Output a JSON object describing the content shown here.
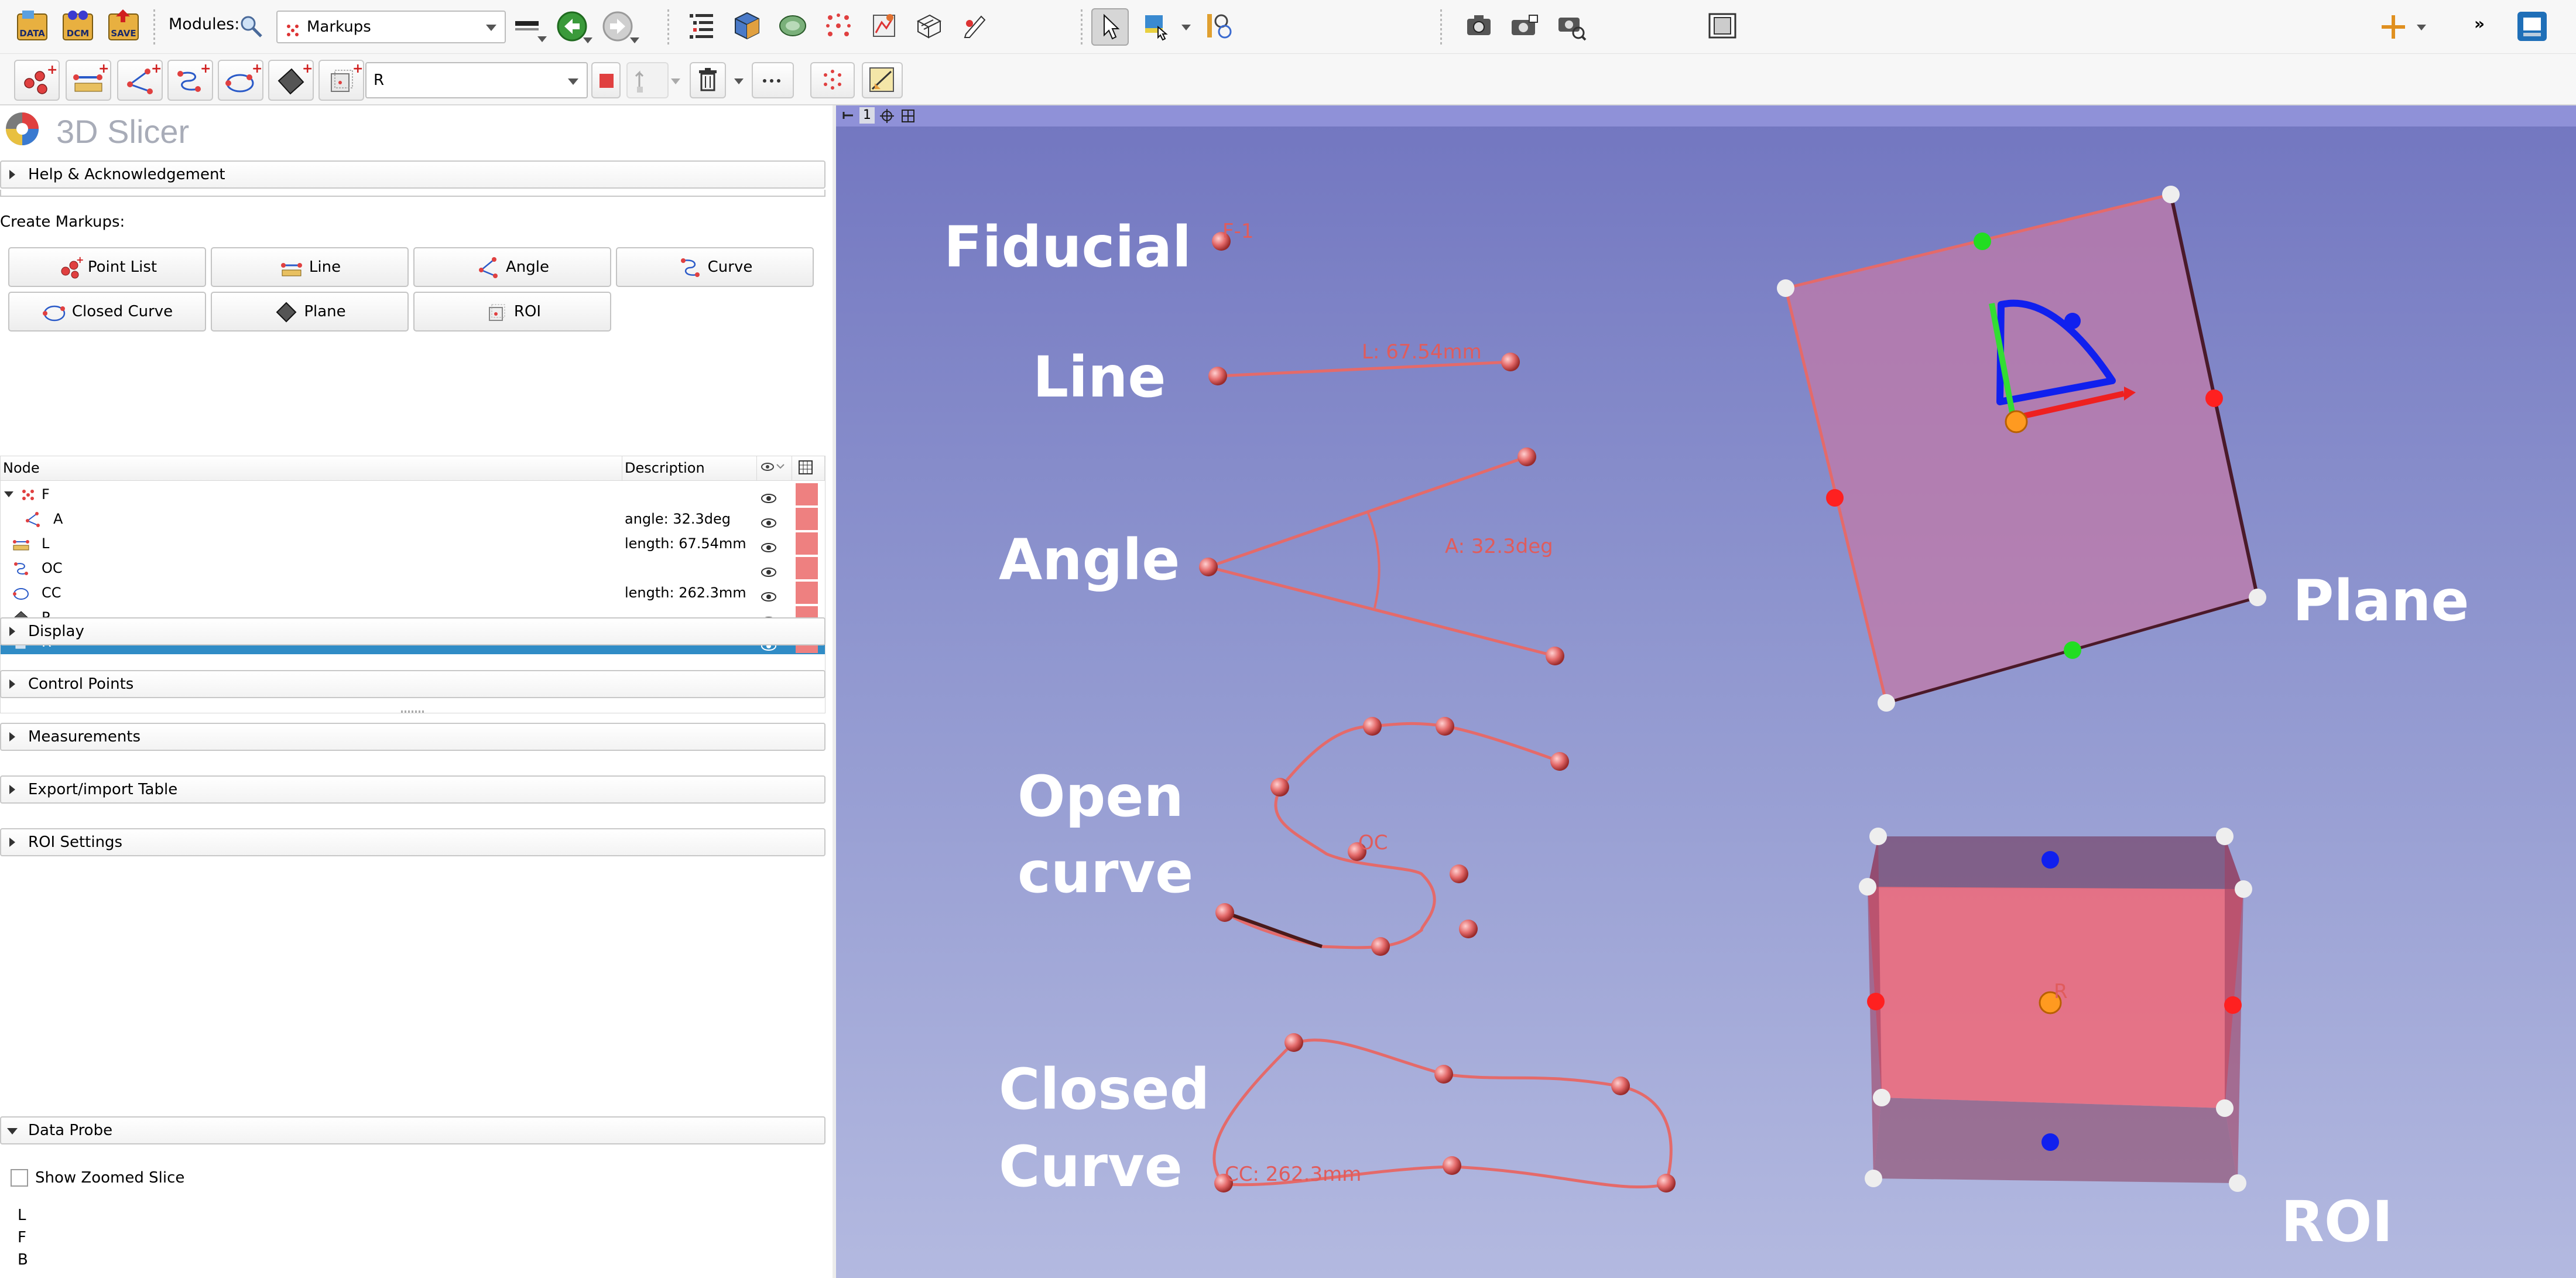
{
  "toolbar": {
    "modules_label": "Modules:",
    "module_selected": "Markups",
    "node_selected": "R"
  },
  "app": {
    "title": "3D Slicer"
  },
  "panel": {
    "help_label": "Help & Acknowledgement",
    "create_markups_label": "Create Markups:",
    "create_buttons": [
      {
        "label": "Point List",
        "icon": "point-list-icon"
      },
      {
        "label": "Line",
        "icon": "line-icon"
      },
      {
        "label": "Angle",
        "icon": "angle-icon"
      },
      {
        "label": "Curve",
        "icon": "curve-icon"
      },
      {
        "label": "Closed Curve",
        "icon": "closed-curve-icon"
      },
      {
        "label": "Plane",
        "icon": "plane-icon"
      },
      {
        "label": "ROI",
        "icon": "roi-icon"
      }
    ],
    "tree": {
      "col_node": "Node",
      "col_description": "Description",
      "rows": [
        {
          "name": "F",
          "description": "",
          "selected": false
        },
        {
          "name": "A",
          "description": "angle: 32.3deg",
          "selected": false
        },
        {
          "name": "L",
          "description": "length: 67.54mm",
          "selected": false
        },
        {
          "name": "OC",
          "description": "",
          "selected": false
        },
        {
          "name": "CC",
          "description": "length: 262.3mm",
          "selected": false
        },
        {
          "name": "P",
          "description": "",
          "selected": false
        },
        {
          "name": "R",
          "description": "",
          "selected": true
        }
      ],
      "swatch_color": "#ee8080",
      "selection_color": "#308cc6"
    },
    "sections": [
      "Display",
      "Control Points",
      "Measurements",
      "Export/import Table",
      "ROI Settings"
    ],
    "data_probe": {
      "label": "Data Probe",
      "show_zoomed_label": "Show Zoomed Slice",
      "lines": [
        "L",
        "F",
        "B"
      ]
    }
  },
  "view": {
    "number": "1",
    "labels": {
      "fiducial": "Fiducial",
      "line": "Line",
      "angle": "Angle",
      "open_curve_1": "Open",
      "open_curve_2": "curve",
      "closed_curve_1": "Closed",
      "closed_curve_2": "Curve",
      "plane": "Plane",
      "roi": "ROI"
    },
    "markup_labels": {
      "fiducial": "F-1",
      "line": "L: 67.54mm",
      "angle": "A: 32.3deg",
      "open_curve": "OC",
      "closed_curve": "CC: 262.3mm",
      "roi": "R"
    },
    "markup_color": "#e06a6a",
    "background_top": "#7276c0",
    "background_bottom": "#b3b9e0"
  }
}
